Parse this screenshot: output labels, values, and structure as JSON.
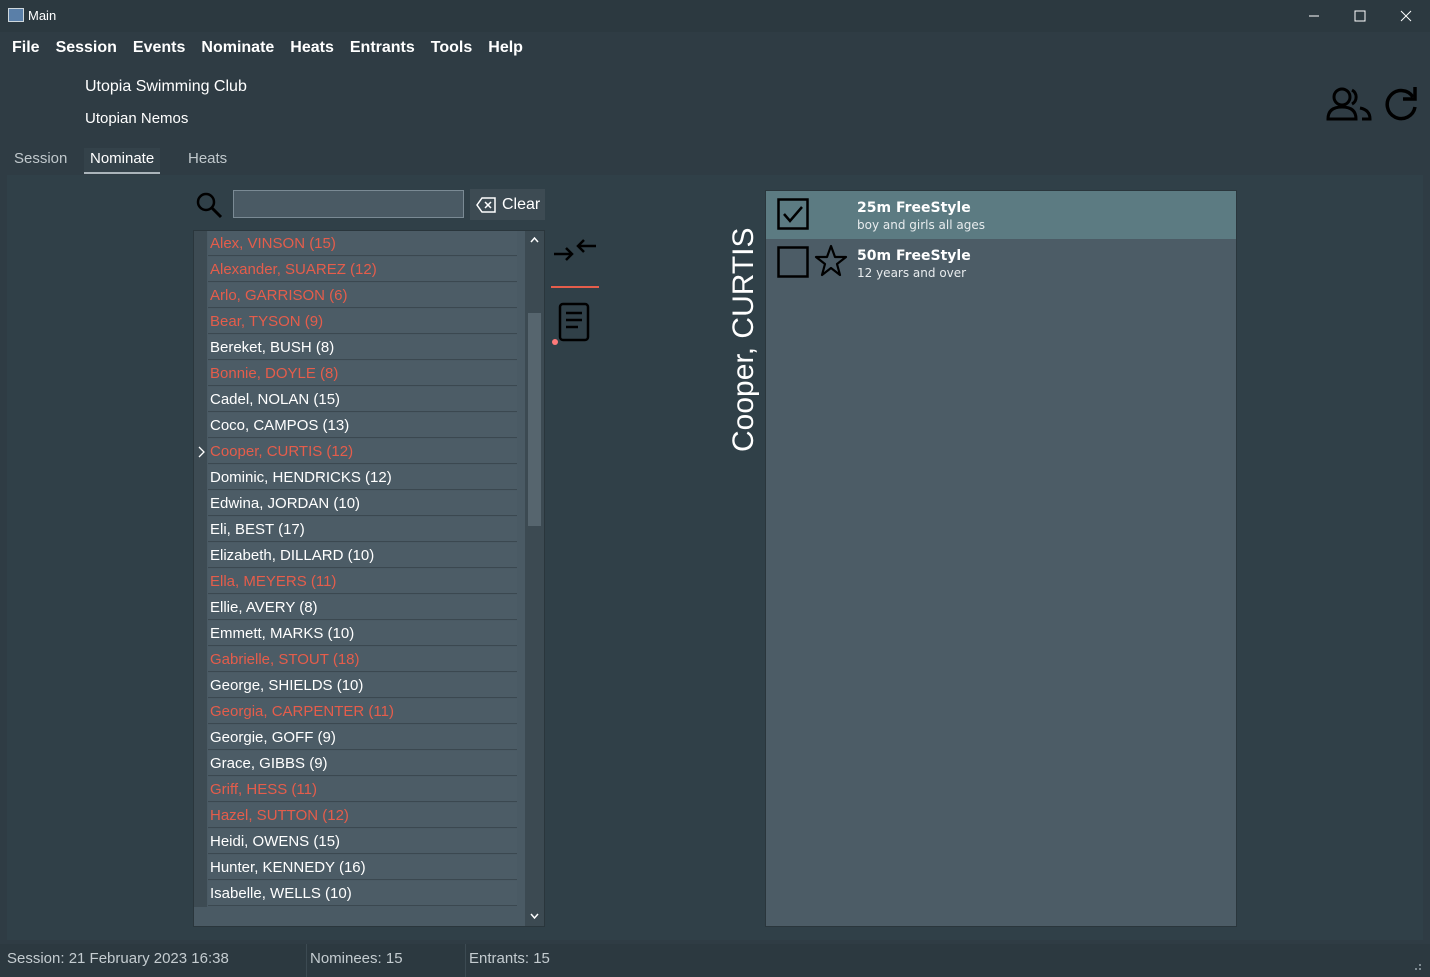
{
  "window": {
    "title": "Main"
  },
  "menu": [
    "File",
    "Session",
    "Events",
    "Nominate",
    "Heats",
    "Entrants",
    "Tools",
    "Help"
  ],
  "header": {
    "club": "Utopia Swimming Club",
    "team": "Utopian Nemos"
  },
  "tabs": [
    {
      "label": "Session",
      "active": false
    },
    {
      "label": "Nominate",
      "active": true
    },
    {
      "label": "Heats",
      "active": false
    }
  ],
  "search": {
    "value": "",
    "clear_label": "Clear"
  },
  "swimmers": [
    {
      "label": "Alex, VINSON (15)",
      "color": "red"
    },
    {
      "label": "Alexander, SUAREZ (12)",
      "color": "red"
    },
    {
      "label": "Arlo, GARRISON (6)",
      "color": "red"
    },
    {
      "label": "Bear, TYSON (9)",
      "color": "red"
    },
    {
      "label": "Bereket, BUSH (8)",
      "color": "white"
    },
    {
      "label": "Bonnie, DOYLE (8)",
      "color": "red"
    },
    {
      "label": "Cadel, NOLAN (15)",
      "color": "white"
    },
    {
      "label": "Coco, CAMPOS (13)",
      "color": "white"
    },
    {
      "label": "Cooper, CURTIS (12)",
      "color": "red",
      "current": true
    },
    {
      "label": "Dominic, HENDRICKS (12)",
      "color": "white"
    },
    {
      "label": "Edwina, JORDAN (10)",
      "color": "white"
    },
    {
      "label": "Eli, BEST (17)",
      "color": "white"
    },
    {
      "label": "Elizabeth, DILLARD (10)",
      "color": "white"
    },
    {
      "label": "Ella, MEYERS (11)",
      "color": "red"
    },
    {
      "label": "Ellie, AVERY (8)",
      "color": "white"
    },
    {
      "label": "Emmett, MARKS (10)",
      "color": "white"
    },
    {
      "label": "Gabrielle, STOUT (18)",
      "color": "red"
    },
    {
      "label": "George, SHIELDS (10)",
      "color": "white"
    },
    {
      "label": "Georgia, CARPENTER (11)",
      "color": "red"
    },
    {
      "label": "Georgie, GOFF (9)",
      "color": "white"
    },
    {
      "label": "Grace, GIBBS (9)",
      "color": "white"
    },
    {
      "label": "Griff, HESS (11)",
      "color": "red"
    },
    {
      "label": "Hazel, SUTTON (12)",
      "color": "red"
    },
    {
      "label": "Heidi, OWENS (15)",
      "color": "white"
    },
    {
      "label": "Hunter, KENNEDY (16)",
      "color": "white"
    },
    {
      "label": "Isabelle, WELLS (10)",
      "color": "white"
    }
  ],
  "selected_swimmer": "Cooper, CURTIS",
  "events": [
    {
      "title": "25m FreeStyle",
      "subtitle": "boy and girls all ages",
      "checked": true,
      "starred": false
    },
    {
      "title": "50m FreeStyle",
      "subtitle": "12 years and over",
      "checked": false,
      "starred": true
    }
  ],
  "status": {
    "session": "Session: 21 February 2023 16:38",
    "nominees": "Nominees: 15",
    "entrants": "Entrants: 15"
  },
  "colors": {
    "red_text": "#e55d4b",
    "selected_event": "#5c7b82"
  }
}
